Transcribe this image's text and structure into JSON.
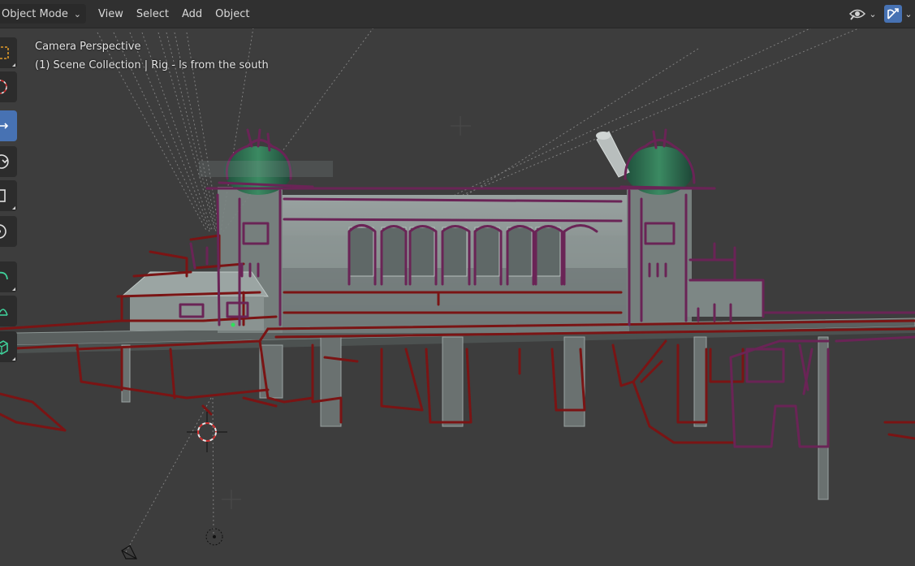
{
  "header": {
    "mode": "Object Mode",
    "menu": [
      "View",
      "Select",
      "Add",
      "Object"
    ]
  },
  "toolbar": {
    "tools": [
      {
        "icon": "select-box-icon",
        "active": false
      },
      {
        "icon": "cursor-icon",
        "active": false
      },
      {
        "icon": "move-icon",
        "active": true
      },
      {
        "icon": "rotate-icon",
        "active": false
      },
      {
        "icon": "scale-icon",
        "active": false
      },
      {
        "icon": "transform-icon",
        "active": false
      },
      {
        "icon": "annotate-icon",
        "active": false
      },
      {
        "icon": "measure-icon",
        "active": false
      },
      {
        "icon": "add-cube-icon",
        "active": false
      }
    ]
  },
  "viewport": {
    "view_name": "Camera Perspective",
    "collection_info": "(1) Scene Collection | Rig - ls from the south"
  },
  "colors": {
    "header_bg": "#303030",
    "viewport_bg": "#3d3d3d",
    "active_tool": "#4772b3",
    "sketch_red": "#7a1414",
    "sketch_purple": "#6a2456",
    "model_gray": "#8f9a98",
    "dome_green": "#2e6b4e"
  }
}
